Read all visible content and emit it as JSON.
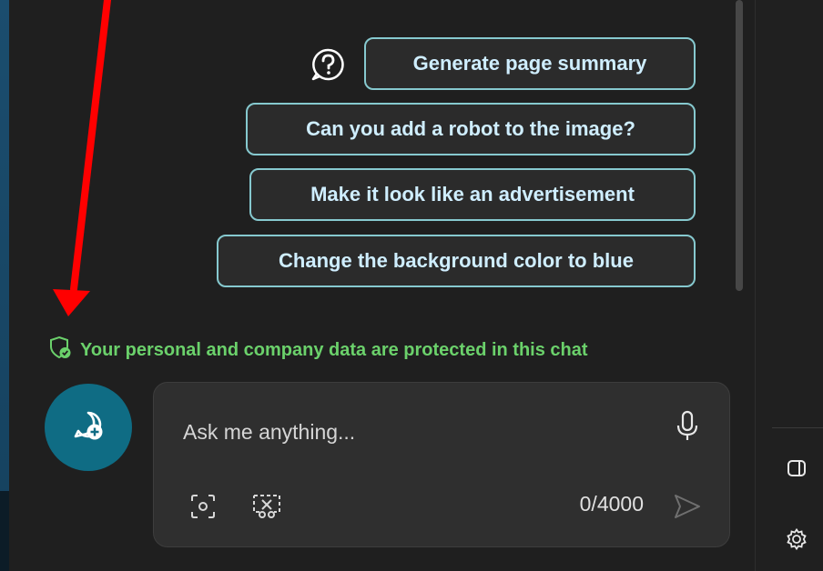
{
  "suggestions": [
    {
      "label": "Generate page summary"
    },
    {
      "label": "Can you add a robot to the image?"
    },
    {
      "label": "Make it look like an advertisement"
    },
    {
      "label": "Change the background color to blue"
    }
  ],
  "privacy_notice": "Your personal and company data are protected in this chat",
  "input": {
    "placeholder": "Ask me anything...",
    "value": "",
    "char_count": "0/4000"
  },
  "icons": {
    "help": "question-circle-icon",
    "privacy": "shield-check-icon",
    "new_chat": "new-topic-icon",
    "mic": "microphone-icon",
    "screenshot": "screenshot-capture-icon",
    "visual_search": "visual-search-icon",
    "send": "send-icon",
    "sidebar": "sidebar-toggle-icon",
    "settings": "gear-icon"
  },
  "colors": {
    "chip_border": "#86c9cf",
    "chip_text": "#cfeeff",
    "privacy_text": "#6bd16b",
    "new_chat_bg": "#0f6c84",
    "annotation_arrow": "#ff0000"
  }
}
